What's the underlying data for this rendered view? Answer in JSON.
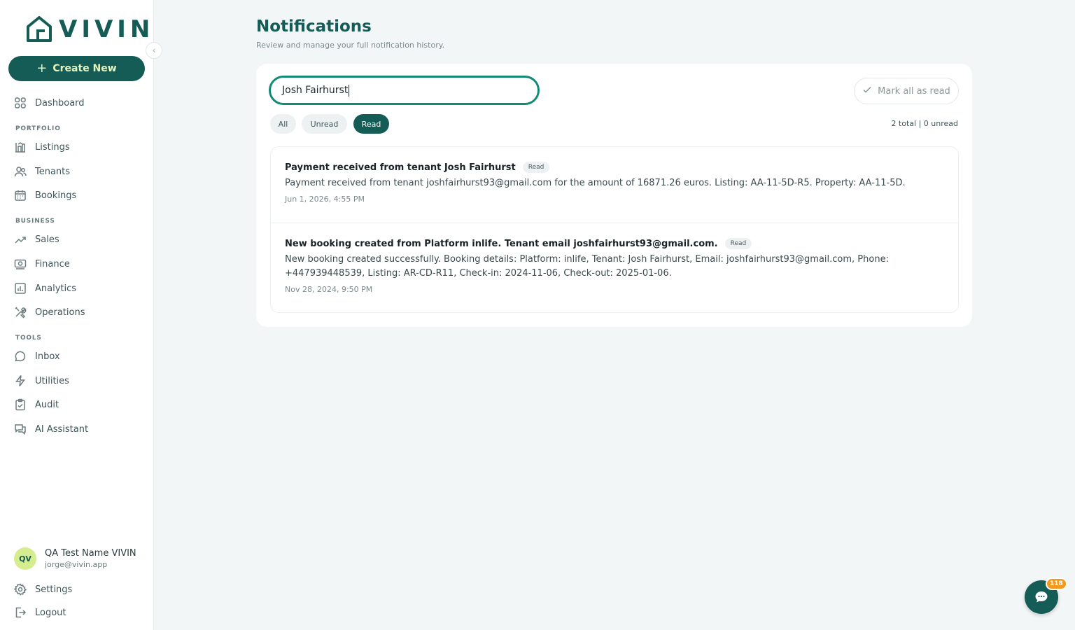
{
  "brand": {
    "name": "VIVIN",
    "accent": "#145c55",
    "focus": "#138a76",
    "badge_color": "#f39a1e"
  },
  "sidebar": {
    "create_label": "Create New",
    "dashboard": "Dashboard",
    "sections": {
      "portfolio": "PORTFOLIO",
      "business": "BUSINESS",
      "tools": "TOOLS"
    },
    "portfolio_items": [
      {
        "label": "Listings",
        "icon": "building-chart-icon"
      },
      {
        "label": "Tenants",
        "icon": "users-icon"
      },
      {
        "label": "Bookings",
        "icon": "calendar-icon"
      }
    ],
    "business_items": [
      {
        "label": "Sales",
        "icon": "trending-up-icon"
      },
      {
        "label": "Finance",
        "icon": "cash-icon"
      },
      {
        "label": "Analytics",
        "icon": "bar-chart-icon"
      },
      {
        "label": "Operations",
        "icon": "tools-icon"
      }
    ],
    "tools_items": [
      {
        "label": "Inbox",
        "icon": "chat-bubble-icon"
      },
      {
        "label": "Utilities",
        "icon": "lightning-icon"
      },
      {
        "label": "Audit",
        "icon": "clipboard-check-icon"
      },
      {
        "label": "AI Assistant",
        "icon": "chat-double-icon"
      }
    ],
    "user": {
      "initials": "QV",
      "name": "QA Test Name VIVIN",
      "email": "jorge@vivin.app"
    },
    "settings": "Settings",
    "logout": "Logout"
  },
  "page": {
    "title": "Notifications",
    "subtitle": "Review and manage your full notification history."
  },
  "search": {
    "value": "Josh Fairhurst"
  },
  "mark_all_label": "Mark all as read",
  "filters": {
    "all": "All",
    "unread": "Unread",
    "read": "Read",
    "selected": "Read"
  },
  "counts": "2 total | 0 unread",
  "notifications": [
    {
      "title": "Payment received from tenant Josh Fairhurst",
      "badge": "Read",
      "body": "Payment received from tenant joshfairhurst93@gmail.com for the amount of 16871.26 euros. Listing: AA-11-5D-R5. Property: AA-11-5D.",
      "time": "Jun 1, 2026, 4:55 PM"
    },
    {
      "title": "New booking created from Platform inlife. Tenant email joshfairhurst93@gmail.com.",
      "badge": "Read",
      "body": "New booking created successfully. Booking details: Platform: inlife, Tenant: Josh Fairhurst, Email: joshfairhurst93@gmail.com, Phone: +447939448539, Listing: AR-CD-R11, Check-in: 2024-11-06, Check-out: 2025-01-06.",
      "time": "Nov 28, 2024, 9:50 PM"
    }
  ],
  "chat": {
    "badge_count": "118"
  }
}
